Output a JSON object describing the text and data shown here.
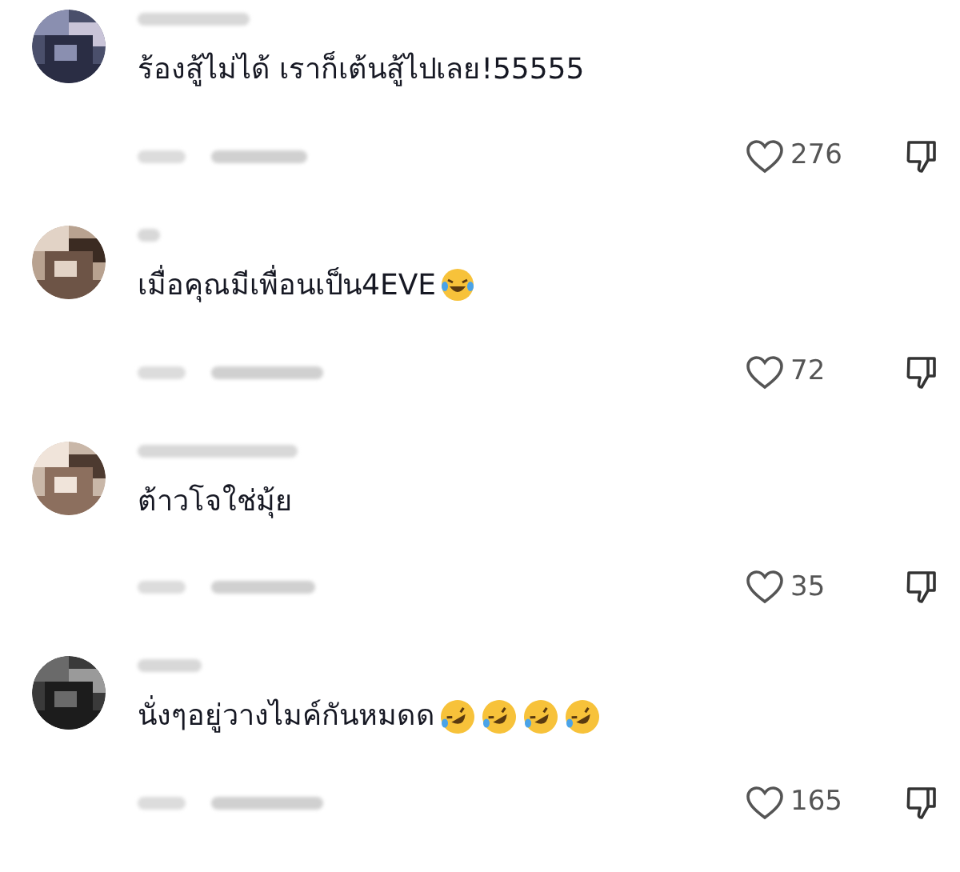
{
  "comments": [
    {
      "text": "ร้องสู้ไม่ได้ เราก็เต้นสู้ไปเลย!55555",
      "likes": "276",
      "liked": false
    },
    {
      "text": "เมื่อคุณมีเพื่อนเป็น4EVE",
      "emoji": [
        {
          "kind": "joy"
        }
      ],
      "likes": "72",
      "liked": false
    },
    {
      "text": "ต้าวโจใช่มุ้ย",
      "likes": "35",
      "liked": false
    },
    {
      "text": "นั่งๆอยู่วางไมค์กันหมดด",
      "emoji": [
        {
          "kind": "rofl"
        },
        {
          "kind": "rofl"
        },
        {
          "kind": "rofl"
        },
        {
          "kind": "rofl"
        }
      ],
      "likes": "165",
      "liked": false
    }
  ]
}
